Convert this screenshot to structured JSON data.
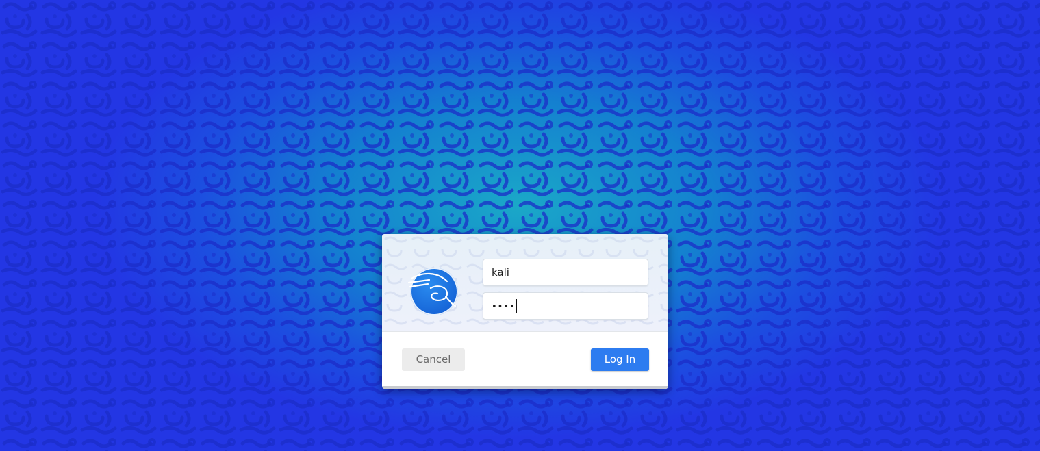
{
  "login_dialog": {
    "username_value": "kali",
    "password_masked": "••••",
    "cancel_label": "Cancel",
    "login_label": "Log In"
  },
  "icons": {
    "avatar": "kali-dragon-logo-icon"
  },
  "colors": {
    "wallpaper_primary": "#2336e4",
    "wallpaper_center": "#1aa8c8",
    "login_button": "#2d7cf0",
    "cancel_button": "#ececec"
  }
}
